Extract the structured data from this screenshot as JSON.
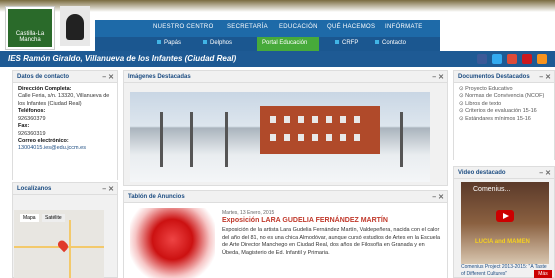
{
  "logo": {
    "text": "Castilla-La Mancha"
  },
  "nav_primary": [
    "NUESTRO CENTRO",
    "SECRETARÍA",
    "EDUCACIÓN",
    "QUÉ HACEMOS",
    "INFÓRMATE"
  ],
  "nav_secondary": [
    "Papás",
    "Delphos",
    "Portal Educación",
    "CRFP",
    "Contacto"
  ],
  "site_title": "IES Ramón Giraldo, Villanueva de los Infantes (Ciudad Real)",
  "contact": {
    "header": "Datos de contacto",
    "address_label": "Dirección Completa:",
    "address": "Calle Feria, s/n. 13320, Villanueva de los Infantes (Ciudad Real)",
    "phone_label": "Teléfonos:",
    "phone": "926360379",
    "fax_label": "Fax:",
    "fax": "926360319",
    "email_label": "Correo electrónico:",
    "email": "13004015.ies@edu.jccm.es"
  },
  "map": {
    "header": "Localízanos",
    "tab_map": "Mapa",
    "tab_sat": "Satélite"
  },
  "featured": {
    "header": "Imágenes Destacadas"
  },
  "board": {
    "header": "Tablón de Anuncios",
    "date": "Martes, 13 Enero, 2015",
    "title": "Exposición LARA GUDELIA FERNÁNDEZ MARTÍN",
    "body": "Exposición de la artista Lara Gudelia Fernández Martín, Valdepeñera, nacida con el calor del año del 81, no es una chica Almodóvar, aunque cursó estudios de Artes en la Escuela de Arte Director Manchego en Ciudad Real, dos años de Filosofía en Granada y en Úbeda, Magisterio de Ed. Infantil y Primaria."
  },
  "docs": {
    "header": "Documentos Destacados",
    "items": [
      "Proyecto Educativo",
      "Normas de Convivencia (NCOF)",
      "Libros de texto",
      "Criterios de evaluación 15-16",
      "Estándares mínimos 15-16"
    ]
  },
  "video": {
    "header": "Video destacado",
    "title": "Comenius...",
    "overlay": "LUCIA and MAMEN",
    "caption": "Comenius Project 2013-2015: \"A Taste of Different Cultures\"",
    "more": "Más"
  },
  "colors": {
    "nav": "#1e6aa8",
    "active": "#47aa3a",
    "banner": "#1e5a94"
  }
}
